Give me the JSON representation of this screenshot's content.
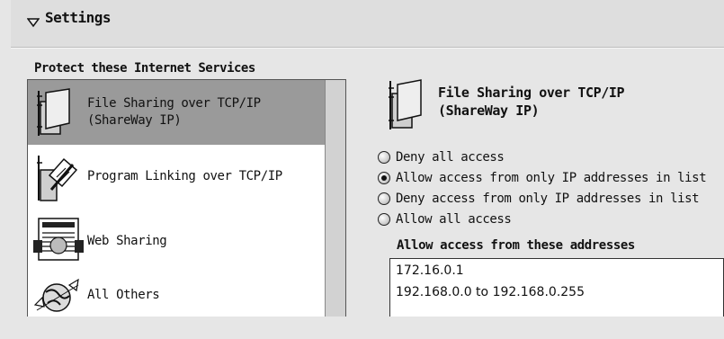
{
  "settings": {
    "title": "Settings",
    "icon": "disclosure-triangle-icon"
  },
  "services": {
    "label": "Protect these Internet Services",
    "items": [
      {
        "line1": "File Sharing over TCP/IP",
        "line2": "(ShareWay IP)",
        "icon": "file-sharing-icon",
        "selected": true
      },
      {
        "line1": "Program Linking over TCP/IP",
        "line2": "",
        "icon": "program-linking-icon",
        "selected": false
      },
      {
        "line1": "Web Sharing",
        "line2": "",
        "icon": "web-sharing-icon",
        "selected": false
      },
      {
        "line1": "All Others",
        "line2": "",
        "icon": "globe-icon",
        "selected": false
      }
    ]
  },
  "detail": {
    "title_line1": "File Sharing over TCP/IP",
    "title_line2": "(ShareWay IP)",
    "icon": "file-sharing-icon",
    "options": [
      {
        "label": "Deny all access",
        "checked": false
      },
      {
        "label": "Allow access from only IP addresses in list",
        "checked": true
      },
      {
        "label": "Deny access from only IP addresses in list",
        "checked": false
      },
      {
        "label": "Allow all access",
        "checked": false
      }
    ],
    "address_label": "Allow access from these addresses",
    "addresses": [
      "172.16.0.1",
      "192.168.0.0 to 192.168.0.255"
    ]
  }
}
